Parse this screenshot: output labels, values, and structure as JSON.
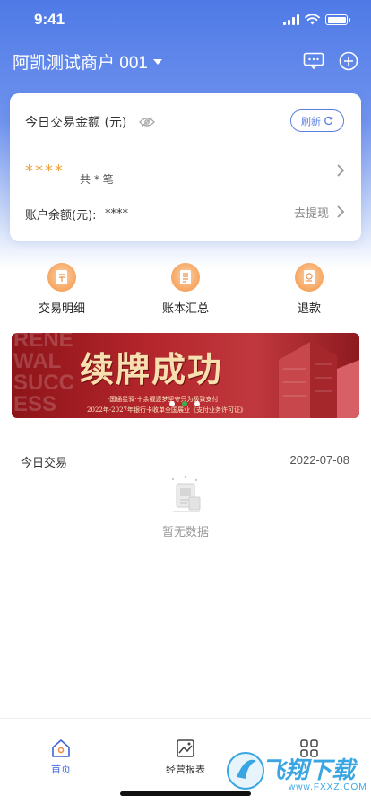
{
  "status_bar": {
    "time": "9:41"
  },
  "header": {
    "merchant_name": "阿凯测试商户 001"
  },
  "summary_card": {
    "title": "今日交易金额 (元)",
    "refresh_label": "刷新",
    "amount_masked": "****",
    "count_text": "共 * 笔",
    "balance_label": "账户余额(元):",
    "balance_masked": "****",
    "withdraw_label": "去提现"
  },
  "quick_menu": [
    {
      "label": "交易明细",
      "icon": "receipt-icon"
    },
    {
      "label": "账本汇总",
      "icon": "ledger-icon"
    },
    {
      "label": "退款",
      "icon": "refund-icon"
    }
  ],
  "banner": {
    "side_text": "RENEWAL SUCCESS",
    "title": "续牌成功",
    "subtitle_1": "·国通星驿·十余载逐梦坚守只为极致支付",
    "subtitle_2": "2022年-2027年银行卡收单全国展业《支付业务许可证》",
    "active_slide": 1,
    "slide_count": 3
  },
  "today": {
    "title": "今日交易",
    "date": "2022-07-08",
    "empty_label": "暂无数据"
  },
  "tabbar": [
    {
      "label": "首页",
      "icon": "home-icon",
      "active": true
    },
    {
      "label": "经营报表",
      "icon": "report-icon",
      "active": false
    },
    {
      "label": "",
      "icon": "apps-grid-icon",
      "active": false
    }
  ],
  "watermark": {
    "text": "飞翔下载",
    "url": "www.FXXZ.COM"
  },
  "colors": {
    "header_blue": "#4f7ae6",
    "accent_blue": "#3d63d6",
    "amount_orange": "#f2a23c",
    "banner_red": "#b4262c",
    "slide_dot_active": "#35b24a"
  }
}
